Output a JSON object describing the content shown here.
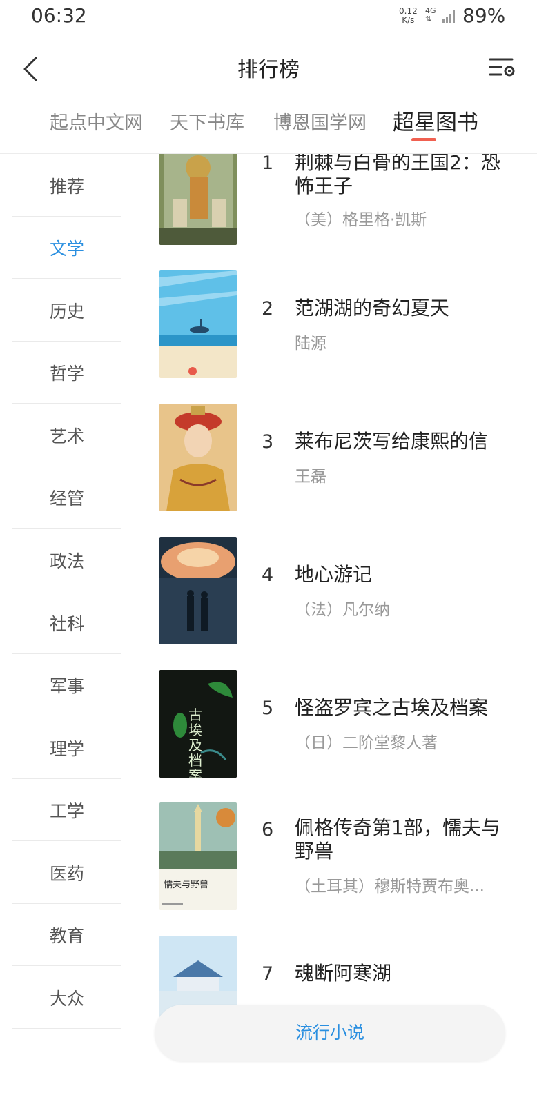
{
  "status_bar": {
    "time": "06:32",
    "net_speed_value": "0.12",
    "net_speed_unit": "K/s",
    "network": "4G",
    "battery": "89%"
  },
  "header": {
    "title": "排行榜"
  },
  "tabs": [
    {
      "label": "起点中文网",
      "active": false
    },
    {
      "label": "天下书库",
      "active": false
    },
    {
      "label": "博恩国学网",
      "active": false
    },
    {
      "label": "超星图书",
      "active": true
    }
  ],
  "categories": [
    {
      "label": "推荐",
      "active": false
    },
    {
      "label": "文学",
      "active": true
    },
    {
      "label": "历史",
      "active": false
    },
    {
      "label": "哲学",
      "active": false
    },
    {
      "label": "艺术",
      "active": false
    },
    {
      "label": "经管",
      "active": false
    },
    {
      "label": "政法",
      "active": false
    },
    {
      "label": "社科",
      "active": false
    },
    {
      "label": "军事",
      "active": false
    },
    {
      "label": "理学",
      "active": false
    },
    {
      "label": "工学",
      "active": false
    },
    {
      "label": "医药",
      "active": false
    },
    {
      "label": "教育",
      "active": false
    },
    {
      "label": "大众",
      "active": false
    }
  ],
  "books": [
    {
      "rank": "1",
      "title": "荆棘与白骨的王国2：恐怖王子",
      "author": "（美）格里格·凯斯"
    },
    {
      "rank": "2",
      "title": "范湖湖的奇幻夏天",
      "author": "陆源"
    },
    {
      "rank": "3",
      "title": "莱布尼茨写给康熙的信",
      "author": "王磊"
    },
    {
      "rank": "4",
      "title": "地心游记",
      "author": "（法）凡尔纳"
    },
    {
      "rank": "5",
      "title": "怪盗罗宾之古埃及档案",
      "author": "（日）二阶堂黎人著"
    },
    {
      "rank": "6",
      "title": "佩格传奇第1部，懦夫与野兽",
      "author": "（土耳其）穆斯特贾布奥..."
    },
    {
      "rank": "7",
      "title": "魂断阿寒湖",
      "author": ""
    }
  ],
  "cover_texts": {
    "book5": "古埃及档案",
    "book6": "懦夫与野兽"
  },
  "float_button": {
    "label": "流行小说"
  },
  "colors": {
    "accent": "#2a8fe0",
    "tab_indicator": "#f06050"
  }
}
